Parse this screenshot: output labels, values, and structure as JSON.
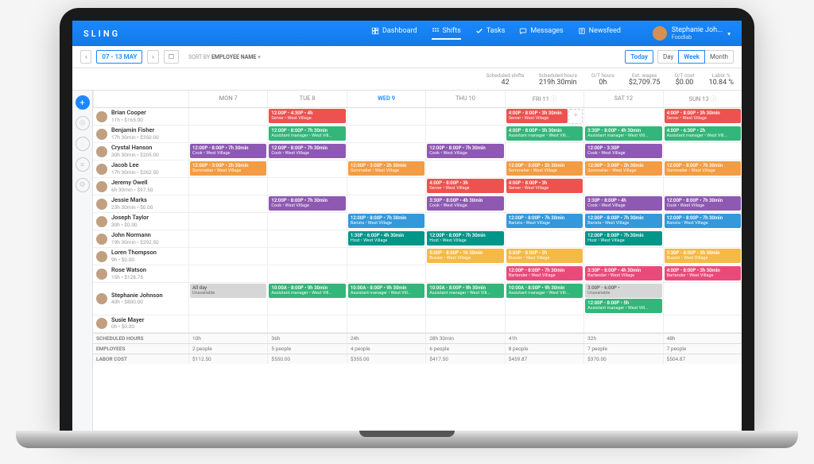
{
  "brand": "SLING",
  "nav": {
    "dashboard": "Dashboard",
    "shifts": "Shifts",
    "tasks": "Tasks",
    "messages": "Messages",
    "newsfeed": "Newsfeed"
  },
  "user": {
    "name": "Stephanie Joh...",
    "org": "Foodlab"
  },
  "toolbar": {
    "date_range": "07 - 13 MAY",
    "sort_label": "SORT BY",
    "sort_value": "EMPLOYEE NAME",
    "today": "Today",
    "day": "Day",
    "week": "Week",
    "month": "Month"
  },
  "stats": {
    "scheduled_shifts": {
      "label": "Scheduled shifts",
      "value": "42"
    },
    "scheduled_hours": {
      "label": "Scheduled hours",
      "value": "219h 30min"
    },
    "ot_hours": {
      "label": "O/T hours",
      "value": "0h"
    },
    "est_wages": {
      "label": "Est. wages",
      "value": "$2,709.75"
    },
    "ot_cost": {
      "label": "O/T cost",
      "value": "$0.00"
    },
    "labor_pct": {
      "label": "Labor %",
      "value": "10.84 %"
    }
  },
  "days": [
    "MON 7",
    "TUE 8",
    "WED 9",
    "THU 10",
    "FRI 11",
    "SAT 12",
    "SUN 13"
  ],
  "active_day_index": 2,
  "employees": [
    {
      "name": "Brian Cooper",
      "sub": "11h • $165.00",
      "shifts": [
        null,
        {
          "c": "red",
          "t": "12:00P - 4:30P • 4h",
          "s": "Server • West Village"
        },
        null,
        null,
        {
          "c": "red",
          "t": "4:00P - 8:00P • 3h 30min",
          "s": "Server • West Village",
          "add": true
        },
        null,
        {
          "c": "red",
          "t": "4:00P - 8:00P • 3h 30min",
          "s": "Server • West Village"
        }
      ]
    },
    {
      "name": "Benjamin Fisher",
      "sub": "17h 30min • $350.00",
      "shifts": [
        null,
        {
          "c": "green",
          "t": "12:00P - 8:00P • 7h 30min",
          "s": "Assistant manager • West Vill..."
        },
        null,
        null,
        {
          "c": "green",
          "t": "4:00P - 8:00P • 3h 30min",
          "s": "Assistant manager • West Vill..."
        },
        {
          "c": "green",
          "t": "3:30P - 8:00P • 4h 30min",
          "s": "Assistant manager • West Vill..."
        },
        {
          "c": "green",
          "t": "4:00P - 6:30P • 2h",
          "s": "Assistant manager • West Vill..."
        }
      ]
    },
    {
      "name": "Crystal Hanson",
      "sub": "30h 30min • $205.00",
      "shifts": [
        {
          "c": "purple",
          "t": "12:00P - 8:00P • 7h 30min",
          "s": "Cook • West Village"
        },
        {
          "c": "purple",
          "t": "12:00P - 8:00P • 7h 30min",
          "s": "Cook • West Village"
        },
        null,
        {
          "c": "purple",
          "t": "12:00P - 8:00P • 7h 30min",
          "s": "Cook • West Village"
        },
        null,
        {
          "c": "purple",
          "t": "12:00P - 3:30P",
          "s": "Cook • West Village"
        },
        null
      ]
    },
    {
      "name": "Jacob Lee",
      "sub": "17h 30min • $262.50",
      "shifts": [
        {
          "c": "orange",
          "t": "12:00P - 3:00P • 2h 30min",
          "s": "Sommelier • West Village"
        },
        null,
        {
          "c": "orange",
          "t": "12:00P - 3:00P • 2h 30min",
          "s": "Sommelier • West Village"
        },
        null,
        {
          "c": "orange",
          "t": "12:00P - 3:00P • 2h 30min",
          "s": "Sommelier • West Village"
        },
        {
          "c": "orange",
          "t": "12:00P - 3:00P • 2h 30min",
          "s": "Sommelier • West Village"
        },
        {
          "c": "orange",
          "t": "12:00P - 8:00P • 7h 30min",
          "s": "Sommelier • West Village"
        }
      ]
    },
    {
      "name": "Jeremy Owell",
      "sub": "6h 30min • $97.50",
      "shifts": [
        null,
        null,
        null,
        {
          "c": "red",
          "t": "4:00P - 8:00P • 3h",
          "s": "Server • West Village"
        },
        {
          "c": "red",
          "t": "4:00P - 8:00P • 3h",
          "s": "Server • West Village"
        },
        null,
        null
      ]
    },
    {
      "name": "Jessie Marks",
      "sub": "23h 30min • $0.00",
      "shifts": [
        null,
        {
          "c": "purple",
          "t": "12:00P - 8:00P • 7h 30min",
          "s": "Cook • West Village"
        },
        null,
        {
          "c": "purple",
          "t": "3:30P - 8:00P • 4h 30min",
          "s": "Cook • West Village"
        },
        null,
        {
          "c": "purple",
          "t": "3:30P - 8:00P • 4h",
          "s": "Cook • West Village"
        },
        {
          "c": "purple",
          "t": "12:00P - 8:00P • 7h 30min",
          "s": "Cook • West Village"
        }
      ]
    },
    {
      "name": "Joseph Taylor",
      "sub": "30h • $0.00",
      "shifts": [
        null,
        null,
        {
          "c": "blue",
          "t": "12:00P - 8:00P • 7h 30min",
          "s": "Barista • West Village"
        },
        null,
        {
          "c": "blue",
          "t": "12:00P - 8:00P • 7h 30min",
          "s": "Barista • West Village"
        },
        {
          "c": "blue",
          "t": "12:00P - 8:00P • 7h 30min",
          "s": "Barista • West Village"
        },
        {
          "c": "blue",
          "t": "12:00P - 8:00P • 7h 30min",
          "s": "Barista • West Village"
        }
      ]
    },
    {
      "name": "John Normann",
      "sub": "19h 30min • $292.50",
      "shifts": [
        null,
        null,
        {
          "c": "teal",
          "t": "1:30P - 6:00P • 4h 30min",
          "s": "Host • West Village"
        },
        {
          "c": "teal",
          "t": "12:00P - 8:00P • 7h 30min",
          "s": "Host • West Village"
        },
        null,
        {
          "c": "teal",
          "t": "12:00P - 8:00P • 7h 30min",
          "s": "Host • West Village"
        },
        null
      ]
    },
    {
      "name": "Loren Thompson",
      "sub": "9h • $0.00",
      "shifts": [
        null,
        null,
        null,
        {
          "c": "yellow",
          "t": "5:00P - 8:00P • 1h 30min",
          "s": "Busser • West Village"
        },
        {
          "c": "yellow",
          "t": "5:00P - 8:00P • 3h",
          "s": "Busser • West Village"
        },
        null,
        {
          "c": "yellow",
          "t": "3:30P - 8:00P • 3h 30min",
          "s": "Busser • West Village"
        }
      ]
    },
    {
      "name": "Rose Watson",
      "sub": "15h • $128.75",
      "shifts": [
        null,
        null,
        null,
        null,
        {
          "c": "rose",
          "t": "12:00P - 8:00P • 7h 30min",
          "s": "Bartender • West Village"
        },
        {
          "c": "rose",
          "t": "3:30P - 8:00P • 4h 30min",
          "s": "Bartender • West Village"
        },
        {
          "c": "rose",
          "t": "4:00P - 8:00P • 3h 30min",
          "s": "Bartender • West Village"
        }
      ]
    },
    {
      "name": "Stephanie Johnson",
      "sub": "40h • $800.00",
      "shifts": [
        {
          "c": "gray",
          "t": "All day",
          "s": "Unavailable"
        },
        {
          "c": "green",
          "t": "10:00A - 8:00P • 9h 30min",
          "s": "Assistant manager • West Vill..."
        },
        {
          "c": "green",
          "t": "10:00A - 8:00P • 9h 30min",
          "s": "Assistant manager • West Vill..."
        },
        {
          "c": "green",
          "t": "10:00A - 8:00P • 9h 30min",
          "s": "Assistant manager • West Vill..."
        },
        {
          "c": "green",
          "t": "10:00A - 8:00P • 9h 30min",
          "s": "Assistant manager • West Vill..."
        },
        {
          "c": "gray",
          "t": "3:00P - 6:00P •",
          "s": "Unavailable"
        },
        null
      ],
      "extra_sat": {
        "c": "green",
        "t": "12:00P - 8:00P • 5h",
        "s": "Assistant manager • West Vill..."
      }
    },
    {
      "name": "Susie Mayer",
      "sub": "0h • $0.00",
      "shifts": [
        null,
        null,
        null,
        null,
        null,
        null,
        null
      ]
    }
  ],
  "footer": {
    "labels": {
      "hours": "SCHEDULED HOURS",
      "emp": "EMPLOYEES",
      "cost": "LABOR COST"
    },
    "hours": [
      "10h",
      "36h",
      "24h",
      "28h 30min",
      "41h",
      "32h",
      "48h"
    ],
    "emp": [
      "2 people",
      "5 people",
      "4 people",
      "6 people",
      "8 people",
      "7 people",
      "7 people"
    ],
    "cost": [
      "$112.50",
      "$550.00",
      "$355.00",
      "$417.50",
      "$459.87",
      "$370.00",
      "$504.87"
    ]
  }
}
